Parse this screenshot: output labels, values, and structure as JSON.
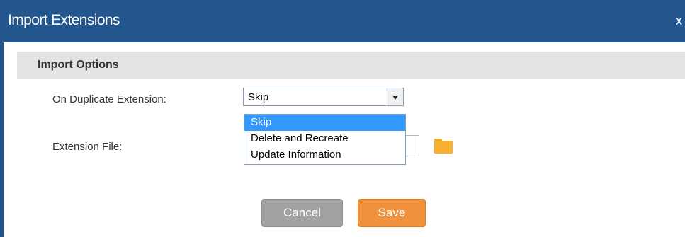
{
  "dialog": {
    "title": "Import Extensions",
    "close_label": "x"
  },
  "section": {
    "title": "Import Options"
  },
  "fields": {
    "duplicate_label": "On Duplicate Extension:",
    "duplicate_value": "Skip",
    "file_label": "Extension File:"
  },
  "dropdown": {
    "options": [
      "Skip",
      "Delete and Recreate",
      "Update Information"
    ],
    "selected_index": 0
  },
  "buttons": {
    "cancel": "Cancel",
    "save": "Save"
  },
  "colors": {
    "titlebar": "#23568c",
    "section_bg": "#e3e3e3",
    "cancel": "#a2a2a2",
    "save": "#f0923d",
    "option_highlight": "#3399ff",
    "folder": "#f7b231"
  },
  "icons": {
    "folder": "folder-icon",
    "dropdown_arrow": "chevron-down-icon"
  }
}
